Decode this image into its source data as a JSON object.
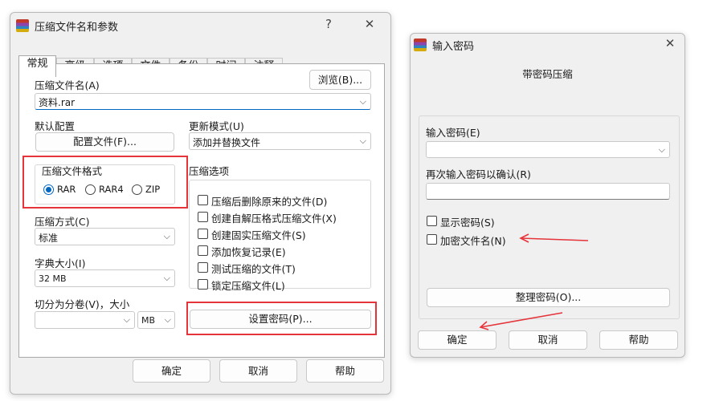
{
  "main_dialog": {
    "title": "压缩文件名和参数",
    "help_glyph": "?",
    "close_glyph": "✕",
    "tabs": [
      "常规",
      "高级",
      "选项",
      "文件",
      "备份",
      "时间",
      "注释"
    ],
    "archive_name_label": "压缩文件名(A)",
    "browse_button": "浏览(B)...",
    "archive_name_value": "资料.rar",
    "default_profile_label": "默认配置",
    "profiles_button": "配置文件(F)...",
    "update_mode_label": "更新模式(U)",
    "update_mode_value": "添加并替换文件",
    "format_group_label": "压缩文件格式",
    "formats": [
      "RAR",
      "RAR4",
      "ZIP"
    ],
    "selected_format": "RAR",
    "options_group_label": "压缩选项",
    "options": [
      {
        "label": "压缩后删除原来的文件(D)",
        "checked": false
      },
      {
        "label": "创建自解压格式压缩文件(X)",
        "checked": false
      },
      {
        "label": "创建固实压缩文件(S)",
        "checked": false
      },
      {
        "label": "添加恢复记录(E)",
        "checked": false
      },
      {
        "label": "测试压缩的文件(T)",
        "checked": false
      },
      {
        "label": "锁定压缩文件(L)",
        "checked": false
      }
    ],
    "method_label": "压缩方式(C)",
    "method_value": "标准",
    "dict_label": "字典大小(I)",
    "dict_value": "32 MB",
    "split_label": "切分为分卷(V)，大小",
    "split_value": "",
    "split_unit": "MB",
    "set_password_button": "设置密码(P)...",
    "ok_button": "确定",
    "cancel_button": "取消",
    "help_button": "帮助"
  },
  "password_dialog": {
    "title": "输入密码",
    "close_glyph": "✕",
    "header": "带密码压缩",
    "enter_label": "输入密码(E)",
    "enter_value": "",
    "reenter_label": "再次输入密码以确认(R)",
    "reenter_value": "",
    "show_password_label": "显示密码(S)",
    "show_password_checked": false,
    "encrypt_names_label": "加密文件名(N)",
    "encrypt_names_checked": false,
    "organize_button": "整理密码(O)...",
    "ok_button": "确定",
    "cancel_button": "取消",
    "help_button": "帮助"
  },
  "colors": {
    "highlight": "#e5343a",
    "accent": "#0067c0",
    "dialog_bg": "#f0f0f0",
    "panel_bg": "#ffffff"
  }
}
